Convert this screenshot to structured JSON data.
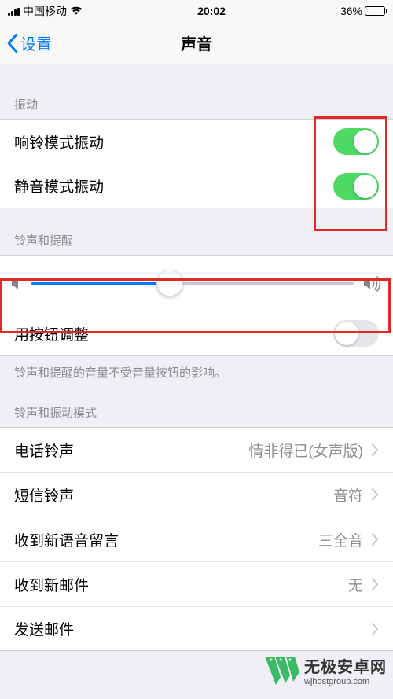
{
  "status": {
    "carrier": "中国移动",
    "time": "20:02",
    "battery_pct_text": "36%",
    "battery_pct": 36
  },
  "nav": {
    "back_label": "设置",
    "title": "声音"
  },
  "sections": {
    "vibrate": {
      "header": "振动",
      "ring_label": "响铃模式振动",
      "ring_on": true,
      "silent_label": "静音模式振动",
      "silent_on": true
    },
    "ringtone": {
      "header": "铃声和提醒",
      "slider_value_pct": 43,
      "button_adjust_label": "用按钮调整",
      "button_adjust_on": false,
      "footer": "铃声和提醒的音量不受音量按钮的影响。"
    },
    "patterns": {
      "header": "铃声和振动模式",
      "items": [
        {
          "label": "电话铃声",
          "value": "情非得已(女声版)"
        },
        {
          "label": "短信铃声",
          "value": "音符"
        },
        {
          "label": "收到新语音留言",
          "value": "三全音"
        },
        {
          "label": "收到新邮件",
          "value": "无"
        },
        {
          "label": "发送邮件",
          "value": ""
        }
      ]
    }
  },
  "watermark": {
    "cn": "无极安卓网",
    "url": "wjhostgroup.com"
  }
}
